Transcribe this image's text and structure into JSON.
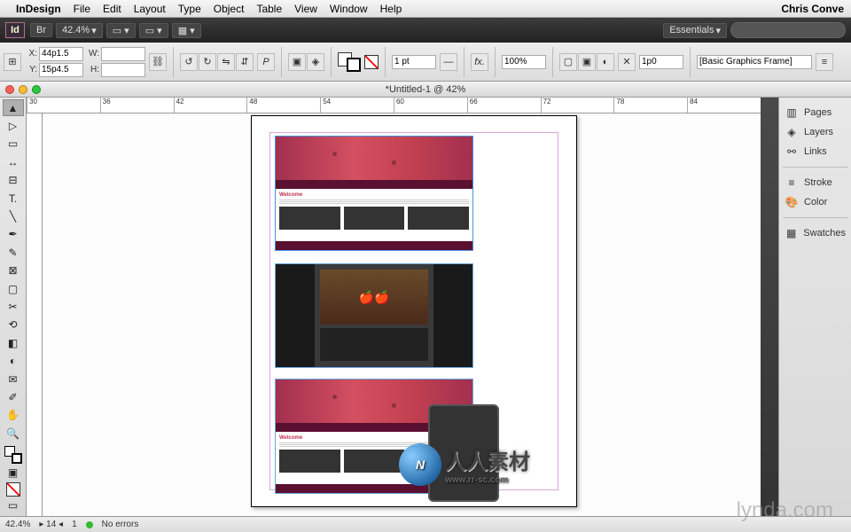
{
  "mac_menu": {
    "app": "InDesign",
    "items": [
      "File",
      "Edit",
      "Layout",
      "Type",
      "Object",
      "Table",
      "View",
      "Window",
      "Help"
    ],
    "user": "Chris Conve"
  },
  "app_bar": {
    "logo": "Id",
    "zoom": "42.4%",
    "workspace": "Essentials"
  },
  "control": {
    "x_label": "X:",
    "x_value": "44p1.5",
    "y_label": "Y:",
    "y_value": "15p4.5",
    "w_label": "W:",
    "w_value": "",
    "h_label": "H:",
    "h_value": "",
    "stroke_weight": "1 pt",
    "opacity": "100%",
    "x_param": "1p0",
    "style": "[Basic Graphics Frame]"
  },
  "document": {
    "title": "*Untitled-1 @ 42%",
    "welcome": "Welcome"
  },
  "ruler": {
    "ticks": [
      "30",
      "36",
      "42",
      "48",
      "54",
      "60",
      "66",
      "72",
      "78",
      "84"
    ]
  },
  "panels": {
    "pages": "Pages",
    "layers": "Layers",
    "links": "Links",
    "stroke": "Stroke",
    "color": "Color",
    "swatches": "Swatches"
  },
  "status": {
    "zoom": "42.4%",
    "page": "1",
    "errors": "No errors"
  },
  "watermark": {
    "logo": "N",
    "text": "人人素材",
    "url": "www.rr-sc.com",
    "lynda": "lynda.com"
  }
}
